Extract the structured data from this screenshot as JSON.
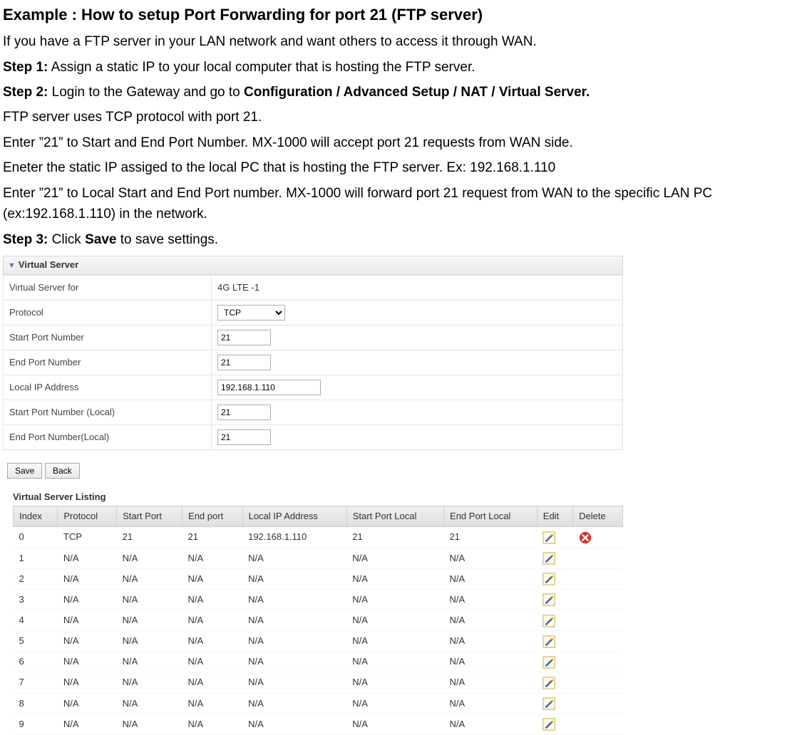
{
  "doc": {
    "title": "Example : How to setup Port Forwarding for port 21 (FTP server)",
    "lines": [
      [
        {
          "text": "If you have a FTP server in your LAN network and want others to access it through WAN."
        }
      ],
      [
        {
          "text": "Step 1:",
          "bold": true
        },
        {
          "text": "  Assign a static IP to your local computer that is hosting the FTP server."
        }
      ],
      [
        {
          "text": "Step 2:",
          "bold": true
        },
        {
          "text": "  Login to the Gateway and go to "
        },
        {
          "text": "Configuration / Advanced Setup / NAT / Virtual Server.",
          "bold": true
        }
      ],
      [
        {
          "text": "FTP server uses TCP protocol with port 21."
        }
      ],
      [
        {
          "text": "Enter ”21” to Start and End Port Number. MX-1000 will accept port 21 requests from WAN side."
        }
      ],
      [
        {
          "text": "Eneter the static IP assiged to the local PC that is hosting the FTP server. Ex: 192.168.1.110"
        }
      ],
      [
        {
          "text": "Enter ”21” to Local Start and End Port number. MX-1000 will forward port 21 request from WAN to the specific LAN PC (ex:192.168.1.110) in the network."
        }
      ],
      [
        {
          "text": "Step 3:",
          "bold": true
        },
        {
          "text": " Click "
        },
        {
          "text": "Save",
          "bold": true
        },
        {
          "text": " to save settings."
        }
      ]
    ]
  },
  "panel": {
    "title": "Virtual Server",
    "form": {
      "virtual_server_for": {
        "label": "Virtual Server for",
        "value": "4G LTE -1"
      },
      "protocol": {
        "label": "Protocol",
        "value": "TCP"
      },
      "start_port": {
        "label": "Start Port Number",
        "value": "21"
      },
      "end_port": {
        "label": "End Port Number",
        "value": "21"
      },
      "local_ip": {
        "label": "Local IP Address",
        "value": "192.168.1.110"
      },
      "start_port_local": {
        "label": "Start Port Number (Local)",
        "value": "21"
      },
      "end_port_local": {
        "label": "End Port Number(Local)",
        "value": "21"
      }
    },
    "buttons": {
      "save": "Save",
      "back": "Back"
    },
    "listing": {
      "title": "Virtual Server Listing",
      "headers": {
        "index": "Index",
        "protocol": "Protocol",
        "start_port": "Start Port",
        "end_port": "End port",
        "local_ip": "Local IP Address",
        "start_port_local": "Start Port Local",
        "end_port_local": "End Port Local",
        "edit": "Edit",
        "delete": "Delete"
      },
      "rows": [
        {
          "index": "0",
          "protocol": "TCP",
          "start_port": "21",
          "end_port": "21",
          "local_ip": "192.168.1.110",
          "start_port_local": "21",
          "end_port_local": "21",
          "deletable": true
        },
        {
          "index": "1",
          "protocol": "N/A",
          "start_port": "N/A",
          "end_port": "N/A",
          "local_ip": "N/A",
          "start_port_local": "N/A",
          "end_port_local": "N/A",
          "deletable": false
        },
        {
          "index": "2",
          "protocol": "N/A",
          "start_port": "N/A",
          "end_port": "N/A",
          "local_ip": "N/A",
          "start_port_local": "N/A",
          "end_port_local": "N/A",
          "deletable": false
        },
        {
          "index": "3",
          "protocol": "N/A",
          "start_port": "N/A",
          "end_port": "N/A",
          "local_ip": "N/A",
          "start_port_local": "N/A",
          "end_port_local": "N/A",
          "deletable": false
        },
        {
          "index": "4",
          "protocol": "N/A",
          "start_port": "N/A",
          "end_port": "N/A",
          "local_ip": "N/A",
          "start_port_local": "N/A",
          "end_port_local": "N/A",
          "deletable": false
        },
        {
          "index": "5",
          "protocol": "N/A",
          "start_port": "N/A",
          "end_port": "N/A",
          "local_ip": "N/A",
          "start_port_local": "N/A",
          "end_port_local": "N/A",
          "deletable": false
        },
        {
          "index": "6",
          "protocol": "N/A",
          "start_port": "N/A",
          "end_port": "N/A",
          "local_ip": "N/A",
          "start_port_local": "N/A",
          "end_port_local": "N/A",
          "deletable": false
        },
        {
          "index": "7",
          "protocol": "N/A",
          "start_port": "N/A",
          "end_port": "N/A",
          "local_ip": "N/A",
          "start_port_local": "N/A",
          "end_port_local": "N/A",
          "deletable": false
        },
        {
          "index": "8",
          "protocol": "N/A",
          "start_port": "N/A",
          "end_port": "N/A",
          "local_ip": "N/A",
          "start_port_local": "N/A",
          "end_port_local": "N/A",
          "deletable": false
        },
        {
          "index": "9",
          "protocol": "N/A",
          "start_port": "N/A",
          "end_port": "N/A",
          "local_ip": "N/A",
          "start_port_local": "N/A",
          "end_port_local": "N/A",
          "deletable": false
        }
      ]
    }
  }
}
